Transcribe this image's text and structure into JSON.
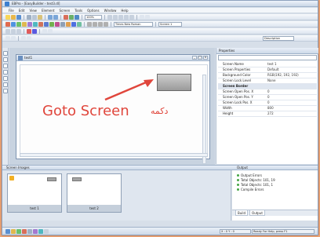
{
  "window": {
    "title": "EBPro - [EasyBuilder - test3.dl]"
  },
  "menu": [
    "File",
    "Edit",
    "View",
    "Element",
    "Screen",
    "Tools",
    "Options",
    "Window",
    "Help"
  ],
  "toolbar": {
    "zoom_value": "100%",
    "font_combo": "Times New Roman",
    "screen_combo": "Screen 1",
    "properties_combo": "Description"
  },
  "screen_window": {
    "title": "test1"
  },
  "annotation": {
    "english": "Goto Screen",
    "persian": "دکمه",
    "arrow_color": "#e0463c"
  },
  "properties": {
    "title": "Properties",
    "rows": [
      {
        "k": "Screen Name",
        "v": "test 1",
        "group": false
      },
      {
        "k": "Screen Properties",
        "v": "Default",
        "group": false
      },
      {
        "k": "Background Color",
        "v": "RGB(192, 192, 192)",
        "group": false
      },
      {
        "k": "Screen Lock Level",
        "v": "None",
        "group": false
      },
      {
        "k": "Screen Border",
        "v": "",
        "group": true
      },
      {
        "k": "Screen Open Pos. X",
        "v": "0",
        "group": false
      },
      {
        "k": "Screen Open Pos. Y",
        "v": "0",
        "group": false
      },
      {
        "k": "Screen Lock Pos. X",
        "v": "0",
        "group": false
      },
      {
        "k": "Width",
        "v": "800",
        "group": false
      },
      {
        "k": "Height",
        "v": "272",
        "group": false
      }
    ]
  },
  "bottom_panels": {
    "screen_images_title": "Screen Images",
    "output_title": "Output"
  },
  "thumbnails": [
    {
      "label": "test 1"
    },
    {
      "label": "test 2"
    }
  ],
  "output": [
    "Output Errors",
    "Total Objects: 101, 19",
    "Total Objects: 101, 1",
    "Compile Errors"
  ],
  "output_tabs": [
    "Build",
    "Output"
  ],
  "status": {
    "coords": "X : 0  Y : 0",
    "message": "Ready   For Help, press F1"
  }
}
